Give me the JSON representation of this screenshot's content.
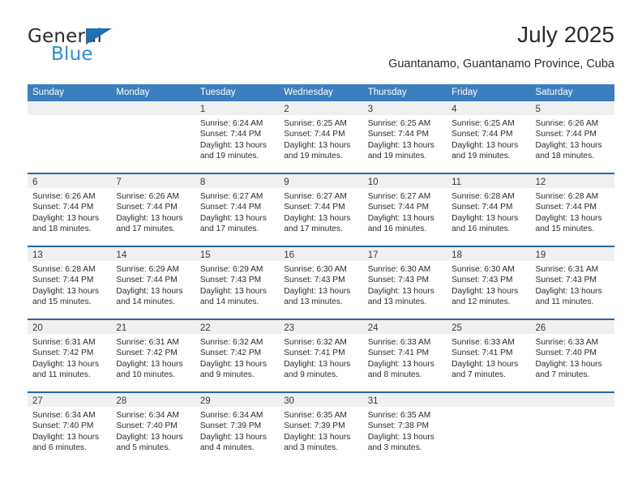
{
  "brand": {
    "name_top": "General",
    "name_bottom": "Blue",
    "accent_blue": "#2a8fd4",
    "triangle_blue": "#1f6fb5"
  },
  "header": {
    "title": "July 2025",
    "location": "Guantanamo, Guantanamo Province, Cuba"
  },
  "theme": {
    "header_row_bg": "#3c7fbf",
    "row_divider": "#2767a6",
    "daynum_band_bg": "#f0f0f0",
    "text": "#2b2b2b"
  },
  "weekdays": [
    "Sunday",
    "Monday",
    "Tuesday",
    "Wednesday",
    "Thursday",
    "Friday",
    "Saturday"
  ],
  "labels": {
    "sunrise_prefix": "Sunrise: ",
    "sunset_prefix": "Sunset: ",
    "daylight_prefix": "Daylight: "
  },
  "weeks": [
    [
      {
        "empty": true,
        "day": ""
      },
      {
        "empty": true,
        "day": ""
      },
      {
        "day": "1",
        "sunrise": "Sunrise: 6:24 AM",
        "sunset": "Sunset: 7:44 PM",
        "daylight": "Daylight: 13 hours and 19 minutes."
      },
      {
        "day": "2",
        "sunrise": "Sunrise: 6:25 AM",
        "sunset": "Sunset: 7:44 PM",
        "daylight": "Daylight: 13 hours and 19 minutes."
      },
      {
        "day": "3",
        "sunrise": "Sunrise: 6:25 AM",
        "sunset": "Sunset: 7:44 PM",
        "daylight": "Daylight: 13 hours and 19 minutes."
      },
      {
        "day": "4",
        "sunrise": "Sunrise: 6:25 AM",
        "sunset": "Sunset: 7:44 PM",
        "daylight": "Daylight: 13 hours and 19 minutes."
      },
      {
        "day": "5",
        "sunrise": "Sunrise: 6:26 AM",
        "sunset": "Sunset: 7:44 PM",
        "daylight": "Daylight: 13 hours and 18 minutes."
      }
    ],
    [
      {
        "day": "6",
        "sunrise": "Sunrise: 6:26 AM",
        "sunset": "Sunset: 7:44 PM",
        "daylight": "Daylight: 13 hours and 18 minutes."
      },
      {
        "day": "7",
        "sunrise": "Sunrise: 6:26 AM",
        "sunset": "Sunset: 7:44 PM",
        "daylight": "Daylight: 13 hours and 17 minutes."
      },
      {
        "day": "8",
        "sunrise": "Sunrise: 6:27 AM",
        "sunset": "Sunset: 7:44 PM",
        "daylight": "Daylight: 13 hours and 17 minutes."
      },
      {
        "day": "9",
        "sunrise": "Sunrise: 6:27 AM",
        "sunset": "Sunset: 7:44 PM",
        "daylight": "Daylight: 13 hours and 17 minutes."
      },
      {
        "day": "10",
        "sunrise": "Sunrise: 6:27 AM",
        "sunset": "Sunset: 7:44 PM",
        "daylight": "Daylight: 13 hours and 16 minutes."
      },
      {
        "day": "11",
        "sunrise": "Sunrise: 6:28 AM",
        "sunset": "Sunset: 7:44 PM",
        "daylight": "Daylight: 13 hours and 16 minutes."
      },
      {
        "day": "12",
        "sunrise": "Sunrise: 6:28 AM",
        "sunset": "Sunset: 7:44 PM",
        "daylight": "Daylight: 13 hours and 15 minutes."
      }
    ],
    [
      {
        "day": "13",
        "sunrise": "Sunrise: 6:28 AM",
        "sunset": "Sunset: 7:44 PM",
        "daylight": "Daylight: 13 hours and 15 minutes."
      },
      {
        "day": "14",
        "sunrise": "Sunrise: 6:29 AM",
        "sunset": "Sunset: 7:44 PM",
        "daylight": "Daylight: 13 hours and 14 minutes."
      },
      {
        "day": "15",
        "sunrise": "Sunrise: 6:29 AM",
        "sunset": "Sunset: 7:43 PM",
        "daylight": "Daylight: 13 hours and 14 minutes."
      },
      {
        "day": "16",
        "sunrise": "Sunrise: 6:30 AM",
        "sunset": "Sunset: 7:43 PM",
        "daylight": "Daylight: 13 hours and 13 minutes."
      },
      {
        "day": "17",
        "sunrise": "Sunrise: 6:30 AM",
        "sunset": "Sunset: 7:43 PM",
        "daylight": "Daylight: 13 hours and 13 minutes."
      },
      {
        "day": "18",
        "sunrise": "Sunrise: 6:30 AM",
        "sunset": "Sunset: 7:43 PM",
        "daylight": "Daylight: 13 hours and 12 minutes."
      },
      {
        "day": "19",
        "sunrise": "Sunrise: 6:31 AM",
        "sunset": "Sunset: 7:43 PM",
        "daylight": "Daylight: 13 hours and 11 minutes."
      }
    ],
    [
      {
        "day": "20",
        "sunrise": "Sunrise: 6:31 AM",
        "sunset": "Sunset: 7:42 PM",
        "daylight": "Daylight: 13 hours and 11 minutes."
      },
      {
        "day": "21",
        "sunrise": "Sunrise: 6:31 AM",
        "sunset": "Sunset: 7:42 PM",
        "daylight": "Daylight: 13 hours and 10 minutes."
      },
      {
        "day": "22",
        "sunrise": "Sunrise: 6:32 AM",
        "sunset": "Sunset: 7:42 PM",
        "daylight": "Daylight: 13 hours and 9 minutes."
      },
      {
        "day": "23",
        "sunrise": "Sunrise: 6:32 AM",
        "sunset": "Sunset: 7:41 PM",
        "daylight": "Daylight: 13 hours and 9 minutes."
      },
      {
        "day": "24",
        "sunrise": "Sunrise: 6:33 AM",
        "sunset": "Sunset: 7:41 PM",
        "daylight": "Daylight: 13 hours and 8 minutes."
      },
      {
        "day": "25",
        "sunrise": "Sunrise: 6:33 AM",
        "sunset": "Sunset: 7:41 PM",
        "daylight": "Daylight: 13 hours and 7 minutes."
      },
      {
        "day": "26",
        "sunrise": "Sunrise: 6:33 AM",
        "sunset": "Sunset: 7:40 PM",
        "daylight": "Daylight: 13 hours and 7 minutes."
      }
    ],
    [
      {
        "day": "27",
        "sunrise": "Sunrise: 6:34 AM",
        "sunset": "Sunset: 7:40 PM",
        "daylight": "Daylight: 13 hours and 6 minutes."
      },
      {
        "day": "28",
        "sunrise": "Sunrise: 6:34 AM",
        "sunset": "Sunset: 7:40 PM",
        "daylight": "Daylight: 13 hours and 5 minutes."
      },
      {
        "day": "29",
        "sunrise": "Sunrise: 6:34 AM",
        "sunset": "Sunset: 7:39 PM",
        "daylight": "Daylight: 13 hours and 4 minutes."
      },
      {
        "day": "30",
        "sunrise": "Sunrise: 6:35 AM",
        "sunset": "Sunset: 7:39 PM",
        "daylight": "Daylight: 13 hours and 3 minutes."
      },
      {
        "day": "31",
        "sunrise": "Sunrise: 6:35 AM",
        "sunset": "Sunset: 7:38 PM",
        "daylight": "Daylight: 13 hours and 3 minutes."
      },
      {
        "empty": true,
        "day": ""
      },
      {
        "empty": true,
        "day": ""
      }
    ]
  ]
}
